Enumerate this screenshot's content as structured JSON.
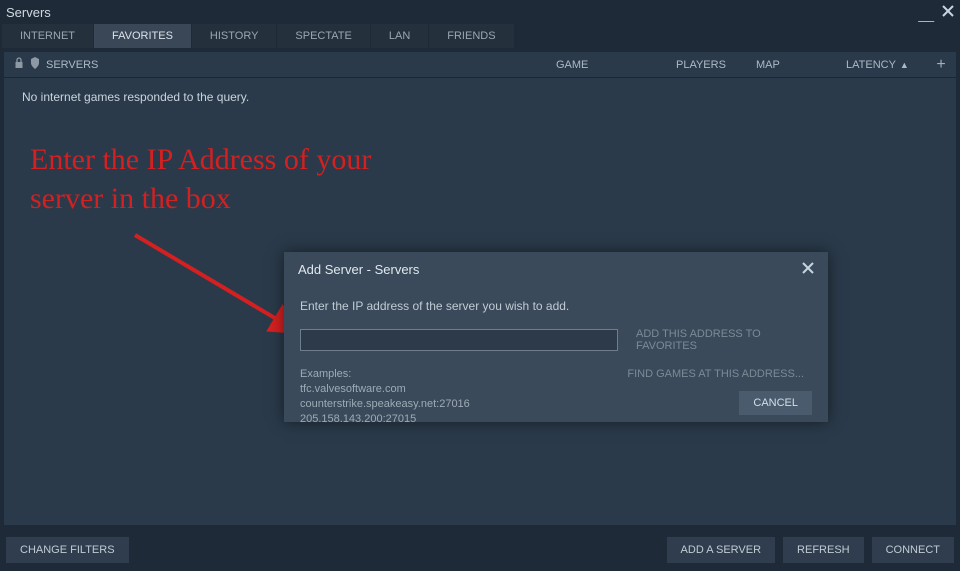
{
  "window": {
    "title": "Servers"
  },
  "tabs": {
    "internet": "INTERNET",
    "favorites": "FAVORITES",
    "history": "HISTORY",
    "spectate": "SPECTATE",
    "lan": "LAN",
    "friends": "FRIENDS"
  },
  "columns": {
    "servers": "SERVERS",
    "game": "GAME",
    "players": "PLAYERS",
    "map": "MAP",
    "latency": "LATENCY"
  },
  "list": {
    "empty_message": "No internet games responded to the query."
  },
  "bottom": {
    "change_filters": "CHANGE FILTERS",
    "add_a_server": "ADD A SERVER",
    "refresh": "REFRESH",
    "connect": "CONNECT"
  },
  "modal": {
    "title": "Add Server - Servers",
    "instruction": "Enter the IP address of the server you wish to add.",
    "add_to_favorites": "ADD THIS ADDRESS TO FAVORITES",
    "find_games": "FIND GAMES AT THIS ADDRESS...",
    "cancel": "CANCEL",
    "examples_header": "Examples:",
    "example1": "tfc.valvesoftware.com",
    "example2": "counterstrike.speakeasy.net:27016",
    "example3": "205.158.143.200:27015",
    "input_value": ""
  },
  "annotation": {
    "line1": "Enter the IP Address of your",
    "line2": "server in the box"
  }
}
